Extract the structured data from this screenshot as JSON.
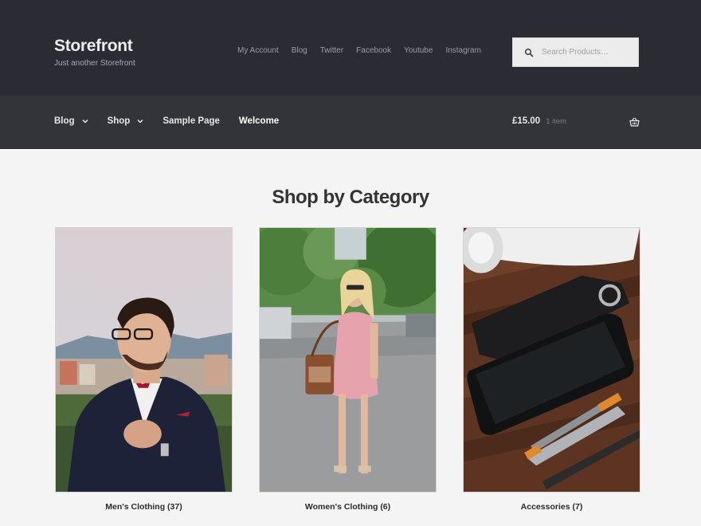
{
  "site": {
    "title": "Storefront",
    "tagline": "Just another Storefront"
  },
  "secondary_nav": [
    "My Account",
    "Blog",
    "Twitter",
    "Facebook",
    "Youtube",
    "Instagram"
  ],
  "search": {
    "placeholder": "Search Products…"
  },
  "primary_nav": {
    "items": [
      {
        "label": "Blog",
        "has_dropdown": true
      },
      {
        "label": "Shop",
        "has_dropdown": true
      },
      {
        "label": "Sample Page",
        "has_dropdown": false
      },
      {
        "label": "Welcome",
        "has_dropdown": false
      }
    ]
  },
  "cart": {
    "amount": "£15.00",
    "count": "1 item"
  },
  "main": {
    "title": "Shop by Category",
    "categories": [
      {
        "name": "Men's Clothing",
        "count": "(37)"
      },
      {
        "name": "Women's Clothing",
        "count": "(6)"
      },
      {
        "name": "Accessories",
        "count": "(7)"
      }
    ]
  },
  "colors": {
    "header_bg": "#2b2c33",
    "nav_bg": "#333439",
    "page_bg": "#f4f4f4",
    "text_dark": "#333333"
  }
}
